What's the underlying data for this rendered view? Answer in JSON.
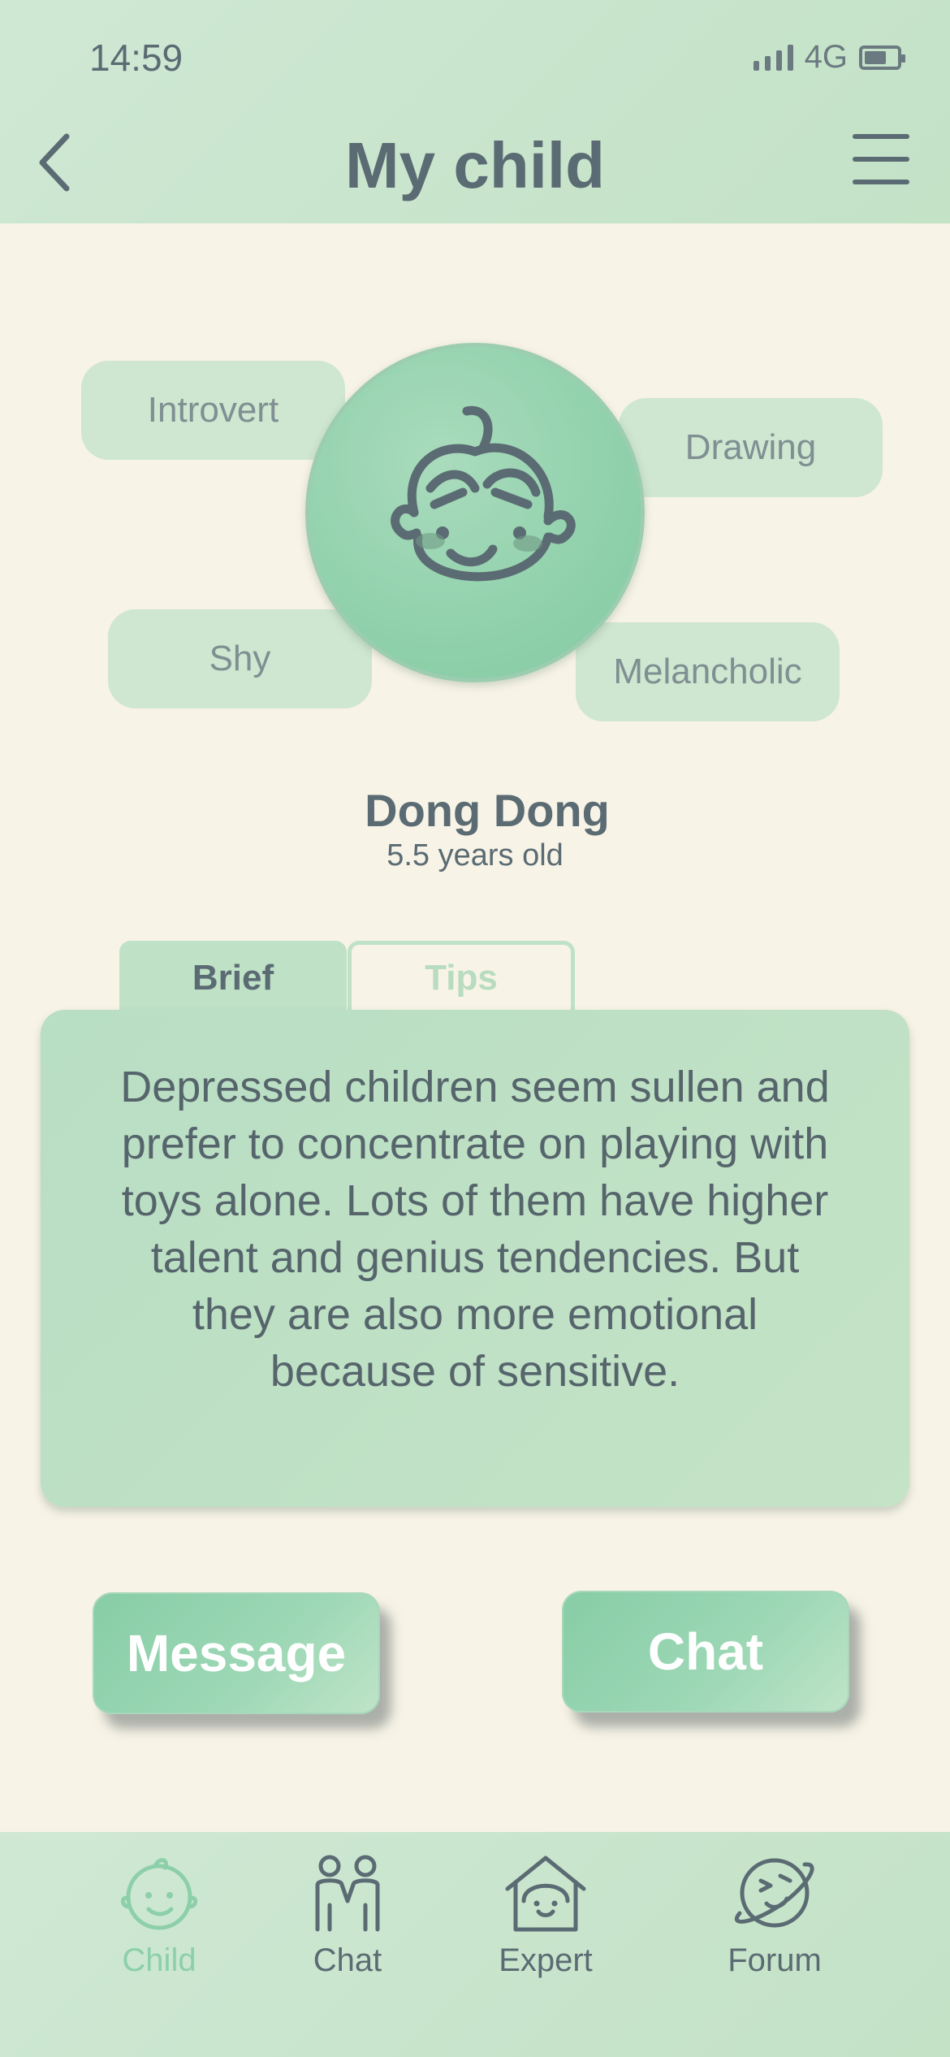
{
  "status_bar": {
    "time": "14:59",
    "network": "4G"
  },
  "header": {
    "title": "My child"
  },
  "tags": [
    "Introvert",
    "Drawing",
    "Shy",
    "Melancholic"
  ],
  "child": {
    "name": "Dong Dong",
    "age": "5.5 years old"
  },
  "tabs": {
    "brief": "Brief",
    "tips": "Tips",
    "active": "brief"
  },
  "brief": {
    "text": "Depressed children seem sullen and prefer to concentrate on playing with toys alone. Lots of them have higher talent and genius tendencies. But they are also more emotional because of sensitive."
  },
  "actions": {
    "message": "Message",
    "chat": "Chat"
  },
  "nav": {
    "active": "child",
    "items": [
      {
        "label": "Child",
        "icon": "child-face-icon"
      },
      {
        "label": "Chat",
        "icon": "people-icon"
      },
      {
        "label": "Expert",
        "icon": "house-face-icon"
      },
      {
        "label": "Forum",
        "icon": "planet-icon"
      }
    ]
  },
  "colors": {
    "accent": "#8ccfa9",
    "header": "#c8e5cc",
    "background": "#f7f3e6",
    "text": "#5b6b73"
  }
}
